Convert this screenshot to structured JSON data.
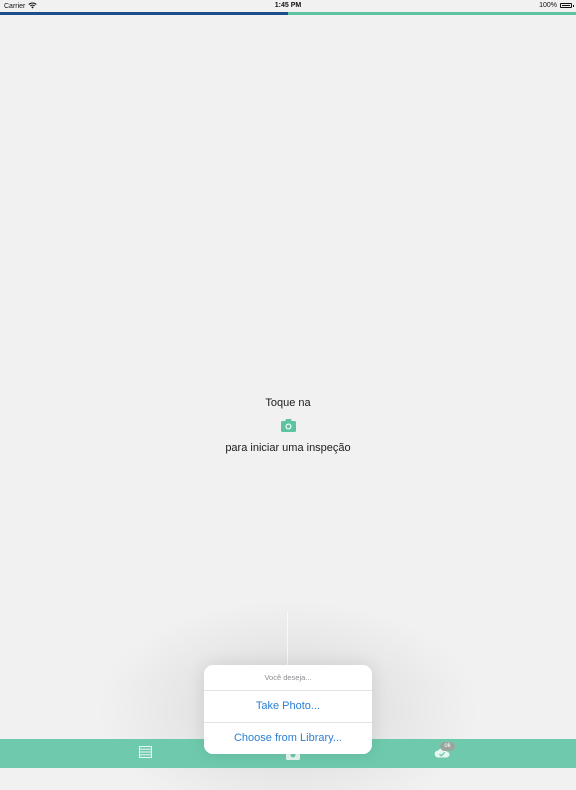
{
  "status_bar": {
    "carrier": "Carrier",
    "time": "1:45 PM",
    "battery": "100%"
  },
  "progress": {
    "fraction": 0.5,
    "fill_color": "#1d4d8a",
    "track_color": "#5ec4a0"
  },
  "empty_state": {
    "line1": "Toque na",
    "icon": "camera-icon",
    "line2": "para iniciar uma inspeção"
  },
  "action_sheet": {
    "title": "Você deseja...",
    "actions": [
      {
        "label": "Take Photo..."
      },
      {
        "label": "Choose from Library..."
      }
    ]
  },
  "tab_bar": {
    "color": "#6fcaad",
    "tabs": [
      {
        "icon": "list-icon"
      },
      {
        "icon": "camera-icon"
      },
      {
        "icon": "cloud-check-icon",
        "badge": "ok"
      }
    ]
  },
  "colors": {
    "accent": "#5ec4a0",
    "link": "#2a7fd4"
  }
}
